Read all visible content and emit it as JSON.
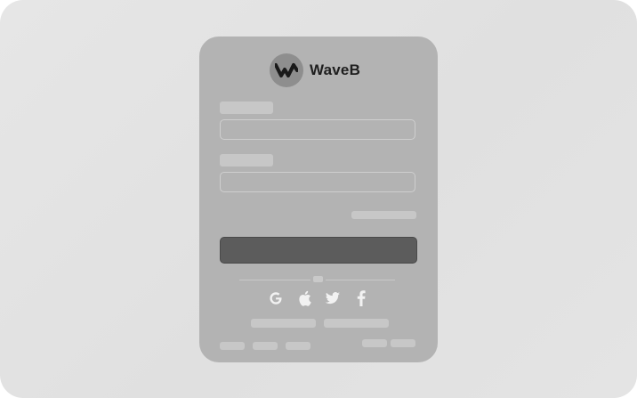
{
  "brand": {
    "name": "WaveB",
    "logo_icon": "wave-logo-icon"
  },
  "form": {
    "username_label_placeholder": "",
    "password_label_placeholder": "",
    "forgot_link_placeholder": "",
    "submit_label": ""
  },
  "social_login": {
    "divider_label": "",
    "providers": [
      "google-icon",
      "apple-icon",
      "twitter-icon",
      "facebook-icon"
    ]
  },
  "colors": {
    "card_background": "#b3b3b3",
    "primary_button": "#5c5c5c",
    "logo_circle": "#8e8e8e",
    "placeholder_block": "#c7c7c7"
  }
}
